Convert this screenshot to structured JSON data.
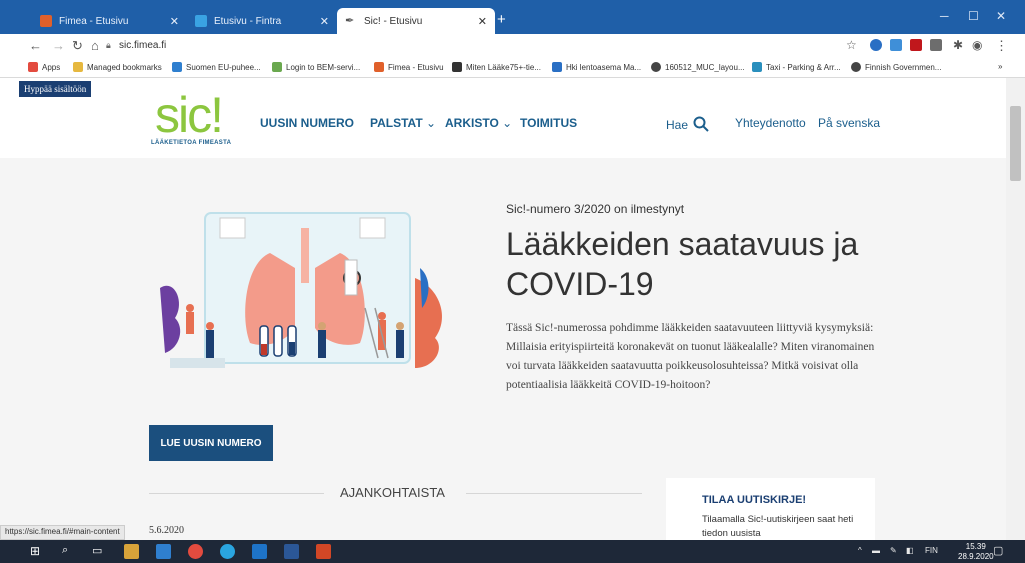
{
  "browser": {
    "tabs": [
      {
        "title": "Fimea - Etusivu",
        "color": "#e0602b"
      },
      {
        "title": "Etusivu - Fintra",
        "color": "#3aa3e3"
      },
      {
        "title": "Sic! - Etusivu",
        "color": "#555555"
      }
    ],
    "new_tab": "+",
    "url": "sic.fimea.fi",
    "bookmarks": [
      {
        "label": "Apps"
      },
      {
        "label": "Managed bookmarks"
      },
      {
        "label": "Suomen EU-puhee..."
      },
      {
        "label": "Login to BEM-servi..."
      },
      {
        "label": "Fimea - Etusivu"
      },
      {
        "label": "Miten Lääke75+-tie..."
      },
      {
        "label": "Hki lentoasema Ma..."
      },
      {
        "label": "160512_MUC_layou..."
      },
      {
        "label": "Taxi - Parking & Arr..."
      },
      {
        "label": "Finnish Governmen..."
      }
    ],
    "bookmarks_more": "»"
  },
  "site": {
    "skip_link": "Hyppää sisältöön",
    "logo": "sic!",
    "logo_subtitle": "LÄÄKETIETOA FIMEASTA",
    "nav": {
      "uusin": "UUSIN NUMERO",
      "palstat": "PALSTAT",
      "arkisto": "ARKISTO",
      "toimitus": "TOIMITUS"
    },
    "search_label": "Hae",
    "contact": "Yhteydenotto",
    "swedish": "På svenska"
  },
  "hero": {
    "kicker": "Sic!-numero 3/2020 on ilmestynyt",
    "title": "Lääkkeiden saatavuus ja COVID-19",
    "body": "Tässä Sic!-numerossa pohdimme lääkkeiden saatavuuteen liittyviä kysymyksiä: Millaisia erityispiirteitä koronakevät on tuonut lääkealalle? Miten viranomainen voi turvata lääkkeiden saatavuutta poikkeusolosuhteissa? Mitkä voisivat olla potentiaalisia lääkkeitä COVID-19-hoitoon?",
    "cta": "LUE UUSIN NUMERO"
  },
  "news": {
    "section_title": "AJANKOHTAISTA",
    "date": "5.6.2020",
    "newsletter_title": "TILAA UUTISKIRJE!",
    "newsletter_text": "Tilaamalla Sic!-uutiskirjeen saat heti tiedon uusista"
  },
  "status_url": "https://sic.fimea.fi/#main-content",
  "taskbar": {
    "lang": "FIN",
    "time": "15.39",
    "date": "28.9.2020"
  },
  "colors": {
    "brand_blue": "#1b5e8c",
    "brand_green": "#8cc63f",
    "chrome_blue": "#1f5fa8"
  }
}
